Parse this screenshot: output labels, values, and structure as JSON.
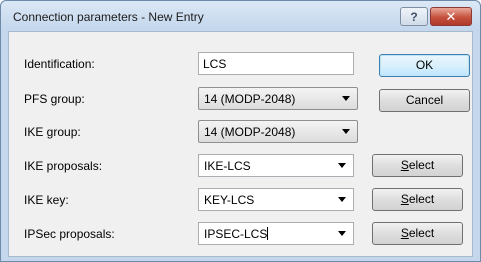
{
  "window": {
    "title": "Connection parameters - New Entry",
    "help_icon": "help-question-icon",
    "close_icon": "close-x-icon",
    "close_color": "#c6513d"
  },
  "fields": {
    "identification": {
      "label": "Identification:",
      "value": "LCS"
    },
    "pfs_group": {
      "label": "PFS group:",
      "value": "14 (MODP-2048)"
    },
    "ike_group": {
      "label": "IKE group:",
      "value": "14 (MODP-2048)"
    },
    "ike_proposals": {
      "label": "IKE proposals:",
      "value": "IKE-LCS"
    },
    "ike_key": {
      "label": "IKE key:",
      "value": "KEY-LCS"
    },
    "ipsec_proposals": {
      "label": "IPSec proposals:",
      "value": "IPSEC-LCS"
    }
  },
  "buttons": {
    "ok": "OK",
    "cancel": "Cancel",
    "select_accel": "S",
    "select_rest": "elect"
  }
}
